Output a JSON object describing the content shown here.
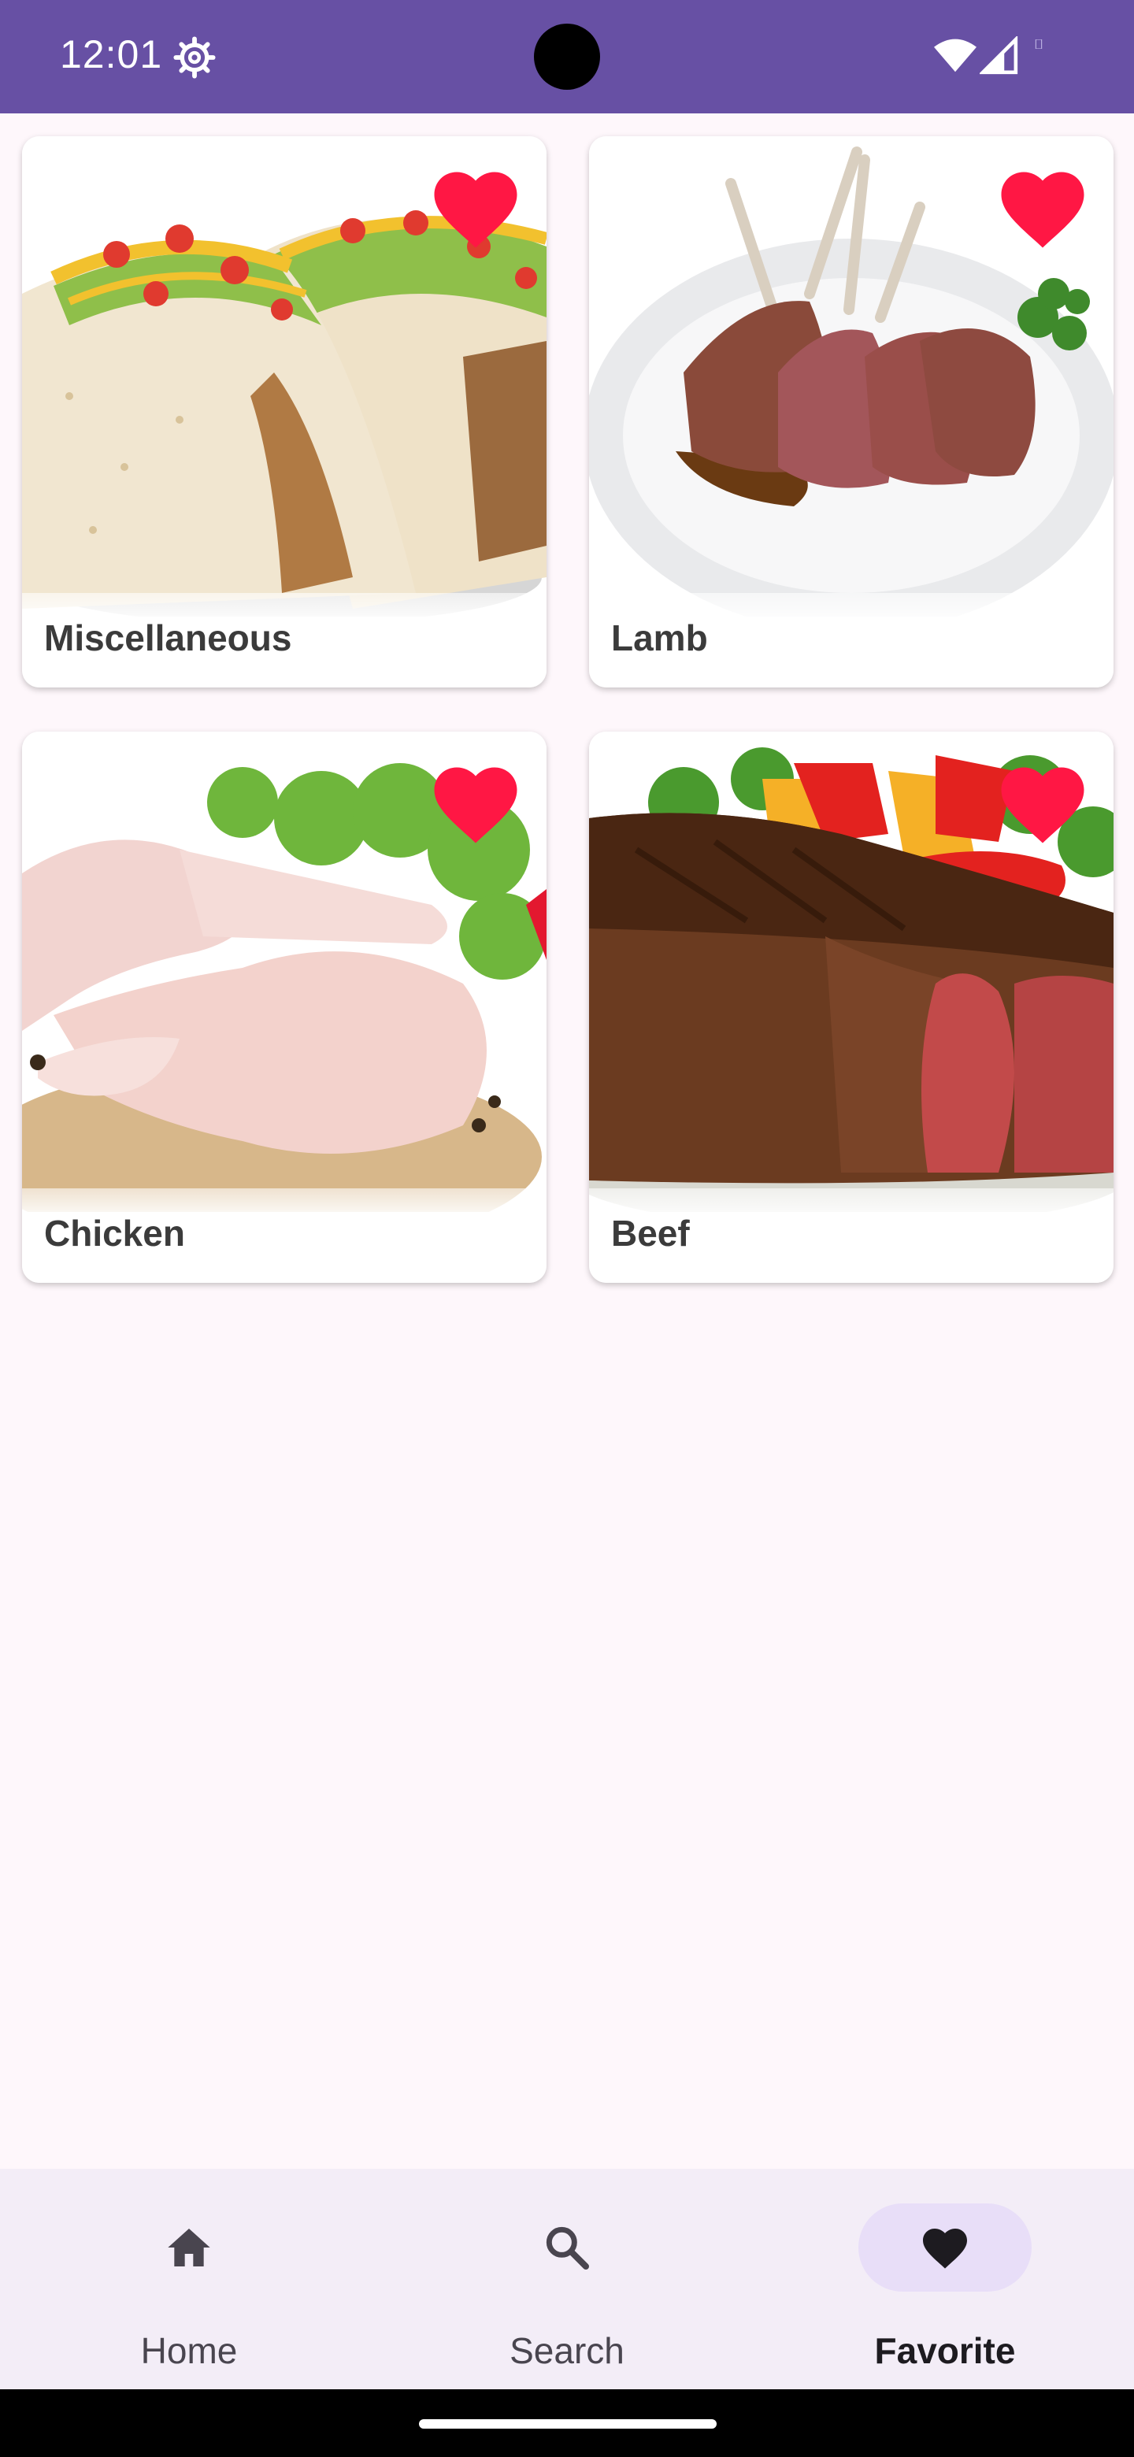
{
  "status_bar": {
    "time": "12:01",
    "background": "#6750a4"
  },
  "categories": [
    {
      "label": "Miscellaneous",
      "favorite": true,
      "image_icon": "taco-image"
    },
    {
      "label": "Lamb",
      "favorite": true,
      "image_icon": "lamb-chops-image"
    },
    {
      "label": "Chicken",
      "favorite": true,
      "image_icon": "chicken-legs-image"
    },
    {
      "label": "Beef",
      "favorite": true,
      "image_icon": "steak-image"
    }
  ],
  "bottom_nav": {
    "items": [
      {
        "label": "Home",
        "icon": "home-icon",
        "active": false
      },
      {
        "label": "Search",
        "icon": "search-icon",
        "active": false
      },
      {
        "label": "Favorite",
        "icon": "heart-icon",
        "active": true
      }
    ]
  },
  "colors": {
    "accent": "#6750a4",
    "heart": "#ff1744",
    "nav_active_pill": "#e8def8",
    "nav_background": "#f3edf7",
    "page_background": "#fef7fb"
  }
}
